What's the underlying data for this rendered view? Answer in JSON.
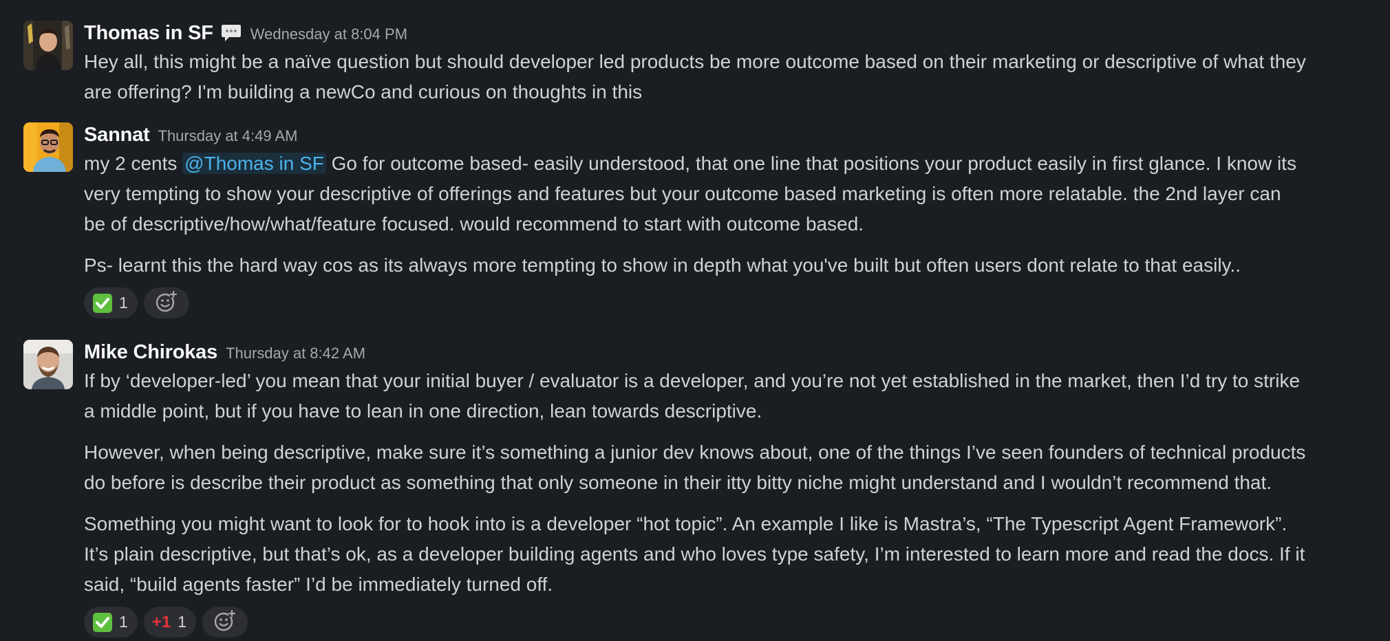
{
  "colors": {
    "background": "#1a1d21",
    "text": "#d1d2d3",
    "author": "#f8f8f8",
    "timestamp": "#a7a8aa",
    "mention": "#4bb3ed",
    "reaction_bg": "#2c2e33",
    "plus_one": "#e8343b"
  },
  "messages": [
    {
      "author": "Thomas in SF",
      "status_icon": "speech-bubble-icon",
      "timestamp": "Wednesday at 8:04 PM",
      "lines": [
        "Hey all, this might be a naïve question but should developer led products be more outcome based on their marketing or descriptive of what they",
        "are offering? I'm building a newCo and curious on thoughts in this"
      ]
    },
    {
      "author": "Sannat",
      "timestamp": "Thursday at 4:49 AM",
      "line1_prefix": "my 2 cents ",
      "mention": "@Thomas in SF",
      "line1_suffix": " Go for outcome based- easily understood, that one line that positions your product easily in first glance. I know its",
      "lines": [
        "very tempting to show your descriptive of offerings and features but your outcome based marketing is often more relatable. the 2nd layer can",
        "be of descriptive/how/what/feature focused. would recommend to start with outcome based."
      ],
      "paragraph2": "Ps- learnt this the hard way cos as its always more tempting to show in depth what you've built but often users dont relate to that easily..",
      "reactions": [
        {
          "emoji": "white-check-mark-icon",
          "count": "1"
        }
      ]
    },
    {
      "author": "Mike Chirokas",
      "timestamp": "Thursday at 8:42 AM",
      "paragraph1": [
        "If by ‘developer-led’ you mean that your initial buyer / evaluator is a developer, and you’re not yet established in the market, then I’d try to strike",
        "a middle point, but if you have to lean in one direction, lean towards descriptive."
      ],
      "paragraph2": [
        "However, when being descriptive, make sure it’s something a junior dev knows about, one of the things I’ve seen founders of technical products",
        "do before is describe their product as something that only someone in their itty bitty niche might understand and I wouldn’t recommend that."
      ],
      "paragraph3": [
        "Something you might want to look for to hook into is a developer “hot topic”. An example I like is Mastra’s, “The Typescript Agent Framework”.",
        "It’s plain descriptive, but that’s ok, as a developer building agents and who loves type safety, I’m interested to learn more and read the docs. If it",
        "said, “build agents faster” I’d be immediately turned off."
      ],
      "reactions": [
        {
          "emoji": "white-check-mark-icon",
          "count": "1"
        },
        {
          "label": "+1",
          "count": "1"
        }
      ]
    }
  ]
}
